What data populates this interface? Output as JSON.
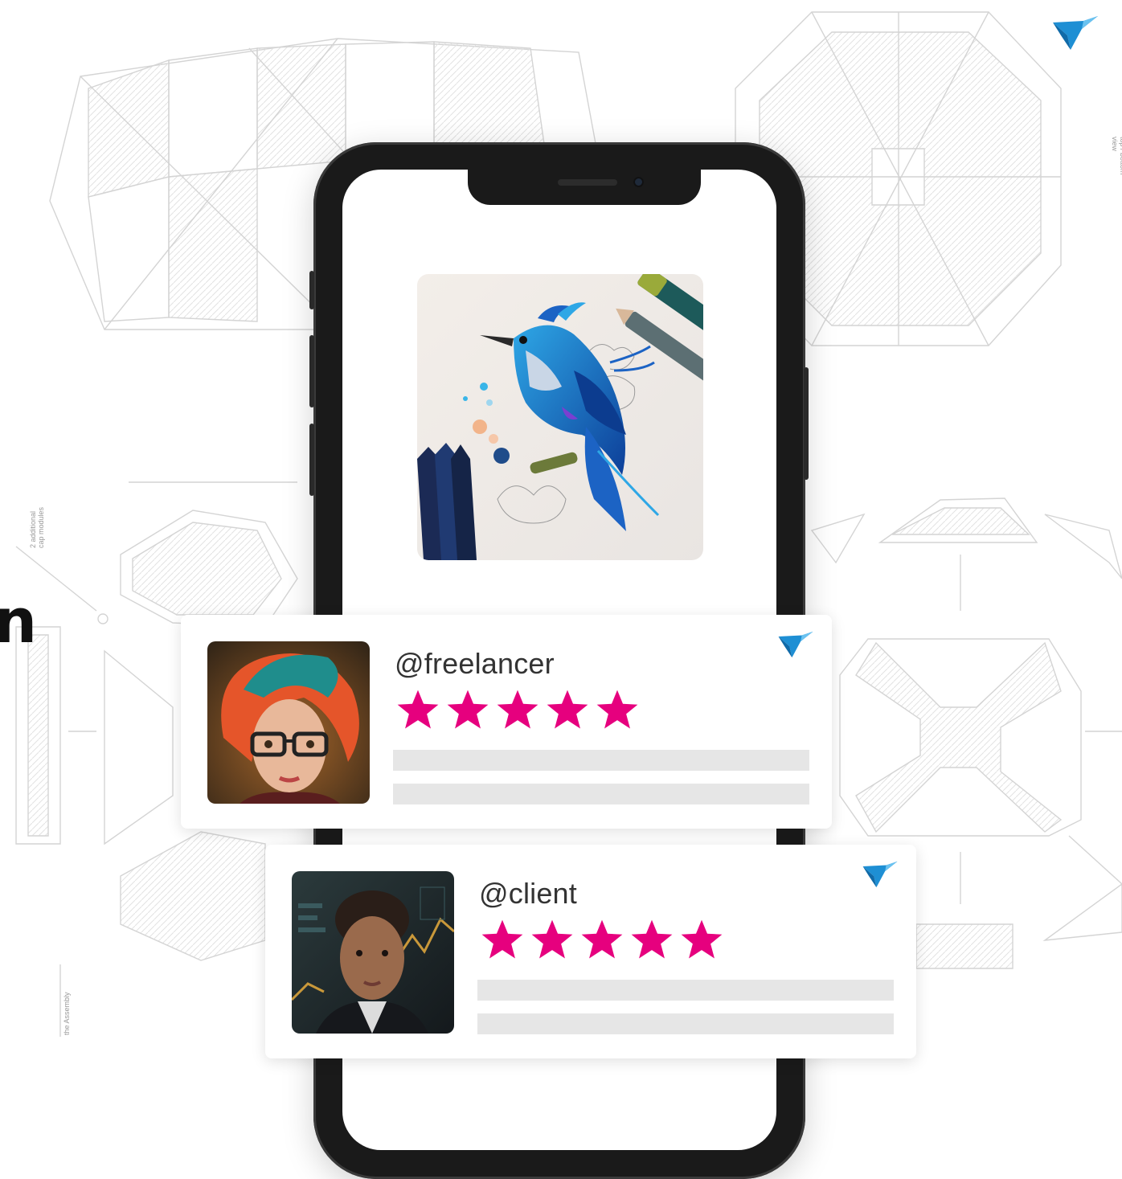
{
  "brand": {
    "logo_icon": "hummingbird-logo-icon",
    "accent_color": "#1e90d6",
    "star_color": "#e6007e"
  },
  "background": {
    "partial_heading_glyph": "n",
    "side_note_top_right": "top / bottom\nview",
    "side_note_left": "2 additional\ncap modules",
    "side_note_bottom_left": "the Assembly"
  },
  "phone": {
    "artwork_icon": "blue-bird-drawing-image"
  },
  "reviews": [
    {
      "handle": "@freelancer",
      "rating": 5,
      "rating_max": 5,
      "avatar_icon": "freelancer-avatar-image",
      "logo_icon": "hummingbird-logo-icon"
    },
    {
      "handle": "@client",
      "rating": 5,
      "rating_max": 5,
      "avatar_icon": "client-avatar-image",
      "logo_icon": "hummingbird-logo-icon"
    }
  ]
}
